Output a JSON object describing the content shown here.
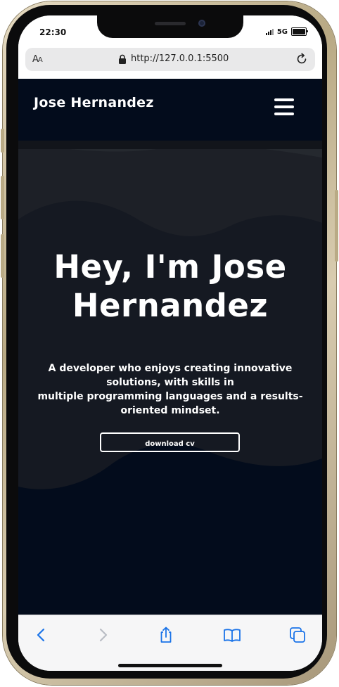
{
  "status_bar": {
    "time": "22:30",
    "network": "5G",
    "icons": [
      "signal-icon",
      "battery-icon"
    ]
  },
  "browser": {
    "text_size_label_large": "A",
    "text_size_label_small": "A",
    "url": "http://127.0.0.1:5500",
    "icons": [
      "lock-icon",
      "reload-icon"
    ]
  },
  "site": {
    "name": "Jose Hernandez",
    "menu_icon": "hamburger-menu-icon",
    "hero": {
      "title_line1": "Hey, I'm Jose",
      "title_line2": "Hernandez",
      "subtitle_line1": "A developer who enjoys creating innovative solutions, with skills in",
      "subtitle_line2": "multiple programming languages and a results-oriented mindset."
    },
    "cta_label": "download cv"
  },
  "colors": {
    "page_background": "#030c1c",
    "text": "#ffffff",
    "browser_accent": "#1a73e8"
  },
  "toolbar": {
    "icons": [
      "back-icon",
      "forward-icon",
      "share-icon",
      "bookmarks-icon",
      "tabs-icon"
    ]
  }
}
